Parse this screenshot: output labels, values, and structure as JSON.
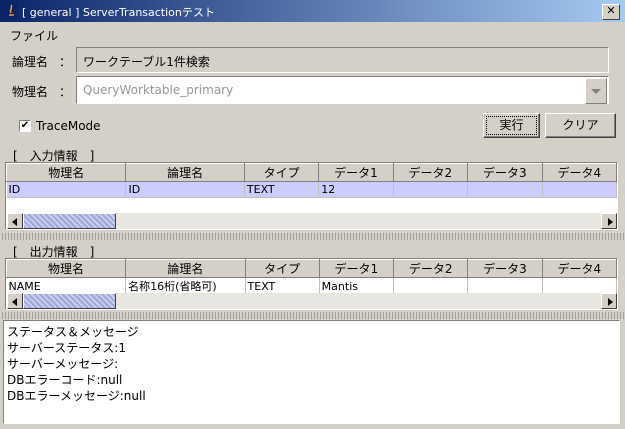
{
  "window": {
    "title": "[ general ] ServerTransactionテスト",
    "close_glyph": "✕"
  },
  "menu": {
    "file": "ファイル"
  },
  "form": {
    "logical_label": "論理名",
    "physical_label": "物理名",
    "colon": "：",
    "logical_value": "ワークテーブル1件検索",
    "physical_value": "QueryWorktable_primary",
    "trace_label": "TraceMode",
    "trace_checked": "✔"
  },
  "buttons": {
    "execute": "実行",
    "clear": "クリア"
  },
  "input_section": {
    "header": "[　入力情報　]",
    "columns": [
      "物理名",
      "論理名",
      "タイプ",
      "データ1",
      "データ2",
      "データ3",
      "データ4"
    ],
    "rows": [
      [
        "ID",
        "ID",
        "TEXT",
        "12",
        "",
        "",
        ""
      ]
    ]
  },
  "output_section": {
    "header": "[　出力情報　]",
    "columns": [
      "物理名",
      "論理名",
      "タイプ",
      "データ1",
      "データ2",
      "データ3",
      "データ4"
    ],
    "rows": [
      [
        "NAME",
        "名称16桁(省略可)",
        "TEXT",
        "Mantis",
        "",
        "",
        ""
      ]
    ]
  },
  "messages": [
    "ステータス＆メッセージ",
    "サーバーステータス:1",
    "サーバーメッセージ:",
    "DBエラーコード:null",
    "DBエラーメッセージ:null"
  ]
}
